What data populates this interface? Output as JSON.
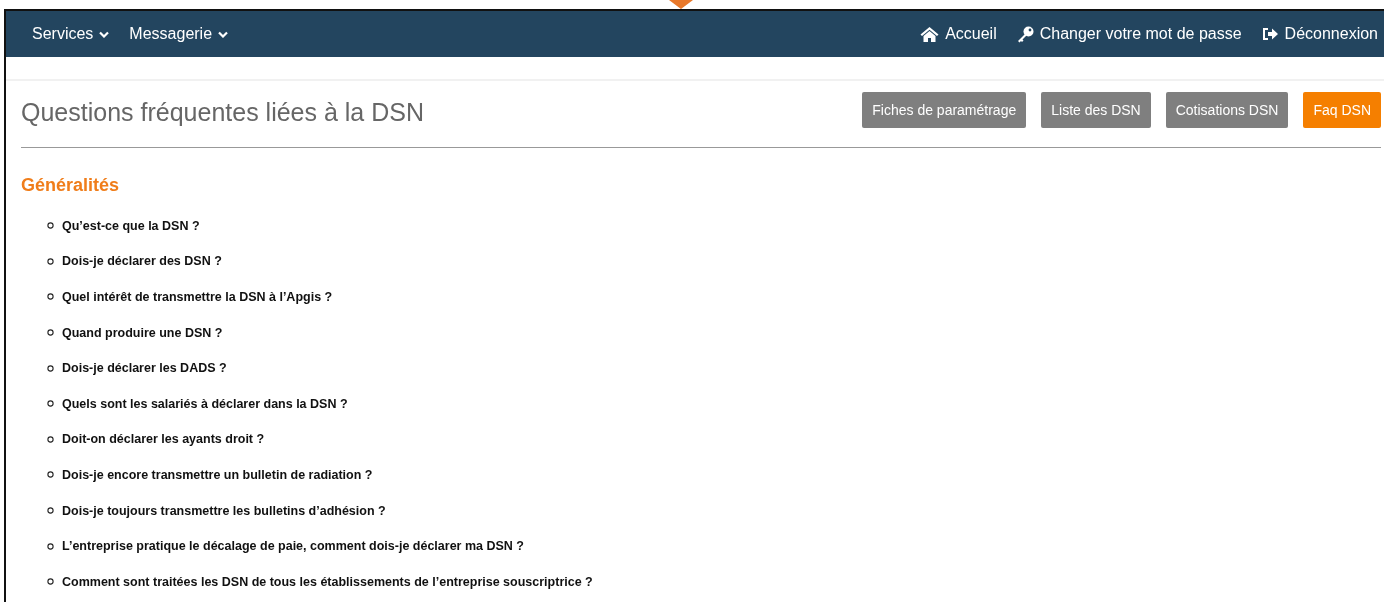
{
  "navbar": {
    "left": [
      {
        "label": "Services"
      },
      {
        "label": "Messagerie"
      }
    ],
    "right": [
      {
        "label": "Accueil"
      },
      {
        "label": "Changer votre mot de passe"
      },
      {
        "label": "Déconnexion"
      }
    ]
  },
  "page": {
    "title": "Questions fréquentes liées à la DSN",
    "tabs": [
      {
        "label": "Fiches de paramétrage",
        "selected": false
      },
      {
        "label": "Liste des DSN",
        "selected": false
      },
      {
        "label": "Cotisations DSN",
        "selected": false
      },
      {
        "label": "Faq DSN",
        "selected": true
      }
    ]
  },
  "section": {
    "heading": "Généralités",
    "questions": [
      "Qu’est-ce que la DSN ?",
      "Dois-je déclarer des DSN ?",
      "Quel intérêt de transmettre la DSN à l’Apgis ?",
      "Quand produire une DSN ?",
      "Dois-je déclarer les DADS ?",
      "Quels sont les salariés à déclarer dans la DSN ?",
      "Doit-on déclarer les ayants droit ?",
      "Dois-je encore transmettre un bulletin de radiation ?",
      "Dois-je toujours transmettre les bulletins d’adhésion ?",
      "L’entreprise pratique le décalage de paie, comment dois-je déclarer ma DSN ?",
      "Comment sont traitées les DSN de tous les établissements de l’entreprise souscriptrice ?"
    ]
  }
}
